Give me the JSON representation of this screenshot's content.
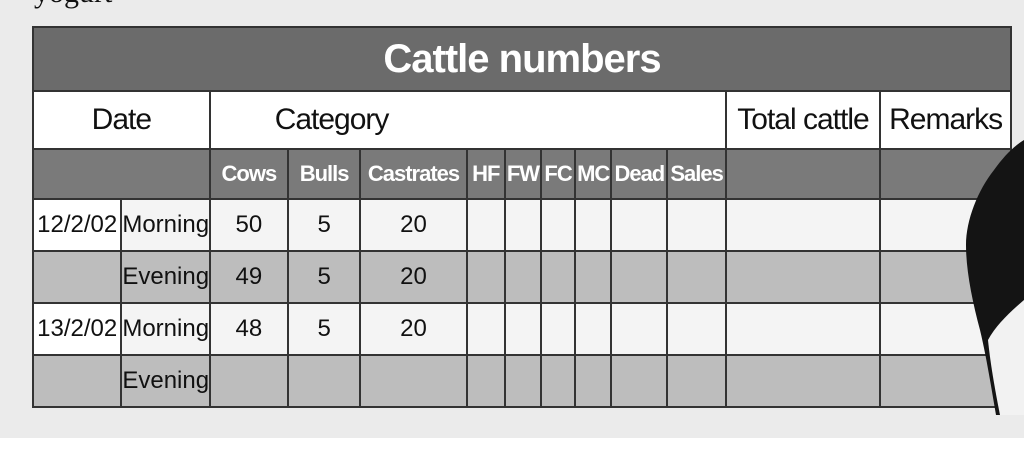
{
  "top_text": "yogurt",
  "table": {
    "title": "Cattle numbers",
    "headers": {
      "date": "Date",
      "category": "Category",
      "total": "Total cattle",
      "remarks": "Remarks"
    },
    "categories": [
      "Cows",
      "Bulls",
      "Castrates",
      "HF",
      "FW",
      "FC",
      "MC",
      "Dead",
      "Sales"
    ],
    "rows": [
      {
        "date": "12/2/02",
        "time": "Morning",
        "values": [
          "50",
          "5",
          "20",
          "",
          "",
          "",
          "",
          "",
          ""
        ],
        "total": "",
        "remarks": ""
      },
      {
        "date": "",
        "time": "Evening",
        "values": [
          "49",
          "5",
          "20",
          "",
          "",
          "",
          "",
          "",
          ""
        ],
        "total": "",
        "remarks": ""
      },
      {
        "date": "13/2/02",
        "time": "Morning",
        "values": [
          "48",
          "5",
          "20",
          "",
          "",
          "",
          "",
          "",
          ""
        ],
        "total": "",
        "remarks": ""
      },
      {
        "date": "",
        "time": "Evening",
        "values": [
          "",
          "",
          "",
          "",
          "",
          "",
          "",
          "",
          ""
        ],
        "total": "",
        "remarks": ""
      }
    ]
  },
  "colors": {
    "title_band": "#6b6b6b",
    "subheader_band": "#7a7a7a",
    "shaded_row": "#bdbdbd",
    "light_row": "#f4f4f4"
  }
}
